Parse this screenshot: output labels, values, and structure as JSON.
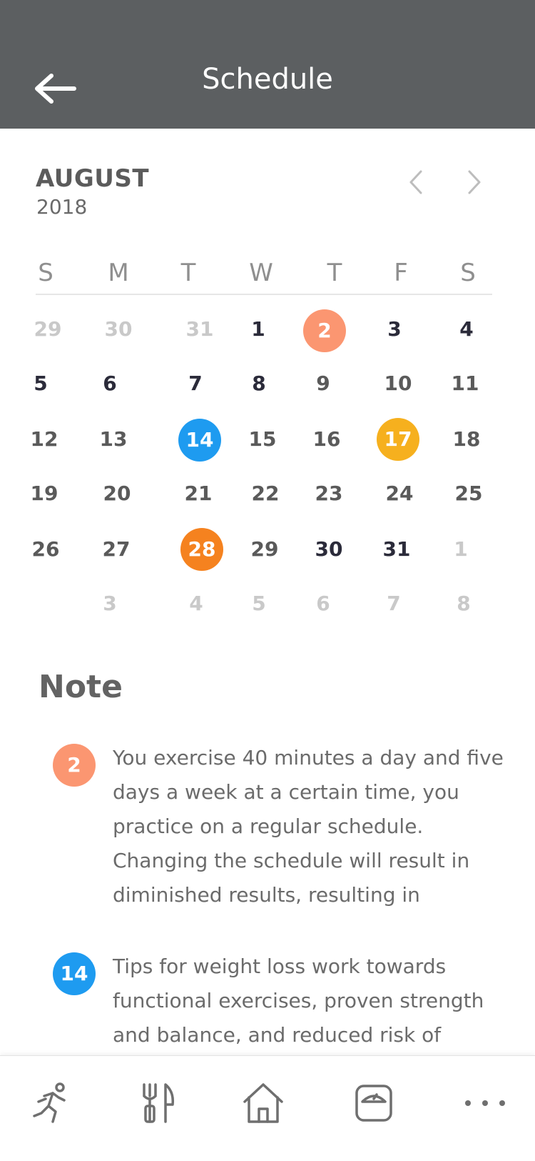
{
  "header": {
    "title": "Schedule"
  },
  "calendar": {
    "month": "AUGUST",
    "year": "2018",
    "weekdays": [
      "S",
      "M",
      "T",
      "W",
      "T",
      "F",
      "S"
    ],
    "weeks": [
      [
        "29",
        "30",
        "31",
        "1",
        "2",
        "3",
        "4"
      ],
      [
        "5",
        "6",
        "7",
        "8",
        "9",
        "10",
        "11"
      ],
      [
        "12",
        "13",
        "14",
        "15",
        "16",
        "17",
        "18"
      ],
      [
        "19",
        "20",
        "21",
        "22",
        "23",
        "24",
        "25"
      ],
      [
        "26",
        "27",
        "28",
        "29",
        "30",
        "31",
        "1"
      ],
      [
        "",
        "3",
        "4",
        "5",
        "6",
        "7",
        "8"
      ]
    ]
  },
  "colors": {
    "salmon": "#fb9671",
    "blue": "#1e9bf0",
    "yellow": "#f6b01e",
    "orange": "#f5821f",
    "header": "#5c5f61"
  },
  "note": {
    "title": "Note",
    "items": [
      {
        "badge": "2",
        "text": "You exercise 40 minutes a day and five days a week at a certain time, you practice on a regular schedule. Changing the schedule will result in diminished results, resulting in"
      },
      {
        "badge": "14",
        "text": "Tips for weight loss work towards functional exercises, proven strength and balance, and reduced risk of"
      }
    ]
  },
  "tabbar": {
    "icons": [
      "running-icon",
      "fork-knife-icon",
      "home-icon",
      "scale-icon",
      "more-icon"
    ]
  }
}
